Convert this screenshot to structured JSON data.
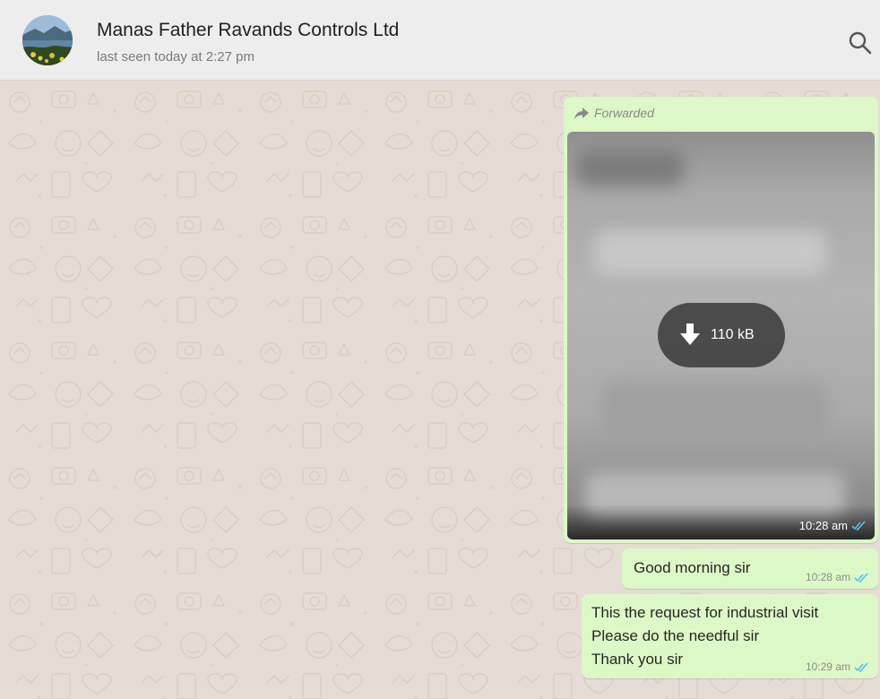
{
  "header": {
    "contact_name": "Manas Father Ravands Controls Ltd",
    "status": "last seen today at 2:27 pm",
    "avatar_icon": "avatar-photo",
    "search_icon": "search-icon"
  },
  "colors": {
    "header_bg": "#ededed",
    "chat_bg": "#e5ddd5",
    "outgoing_bubble": "#dcf8c6",
    "read_tick": "#4fc3f7"
  },
  "messages": [
    {
      "type": "image",
      "forwarded_label": "Forwarded",
      "download_size": "110 kB",
      "time": "10:28 am",
      "status_icon": "double-check-icon"
    },
    {
      "type": "text",
      "text": "Good morning sir",
      "time": "10:28 am",
      "status_icon": "double-check-icon"
    },
    {
      "type": "text",
      "lines": [
        "This the request for industrial visit",
        "Please do the needful sir",
        "Thank you sir"
      ],
      "time": "10:29 am",
      "status_icon": "double-check-icon"
    }
  ]
}
